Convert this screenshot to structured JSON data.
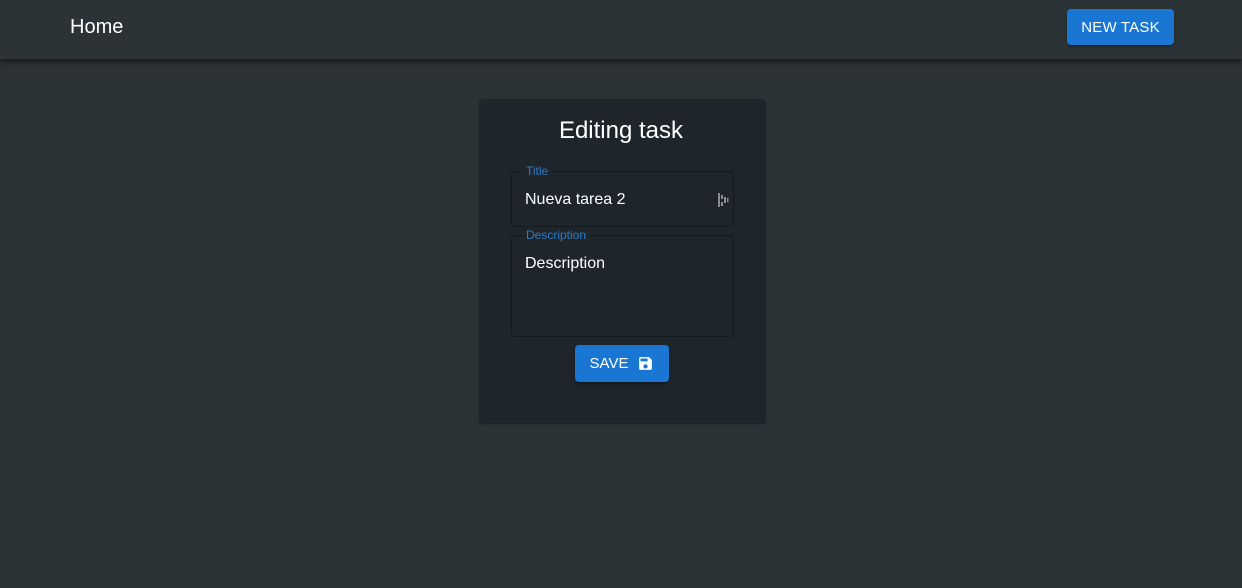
{
  "appbar": {
    "home_label": "Home",
    "new_task_label": "NEW TASK"
  },
  "card": {
    "heading": "Editing task",
    "title_field": {
      "label": "Title",
      "value": "Nueva tarea 2"
    },
    "description_field": {
      "label": "Description",
      "placeholder": "Description"
    },
    "save_label": "SAVE",
    "save_icon": "save-icon"
  },
  "colors": {
    "background": "#2c3336",
    "card": "#1e252b",
    "accent": "#1976d2",
    "label": "#2f7bc8"
  }
}
